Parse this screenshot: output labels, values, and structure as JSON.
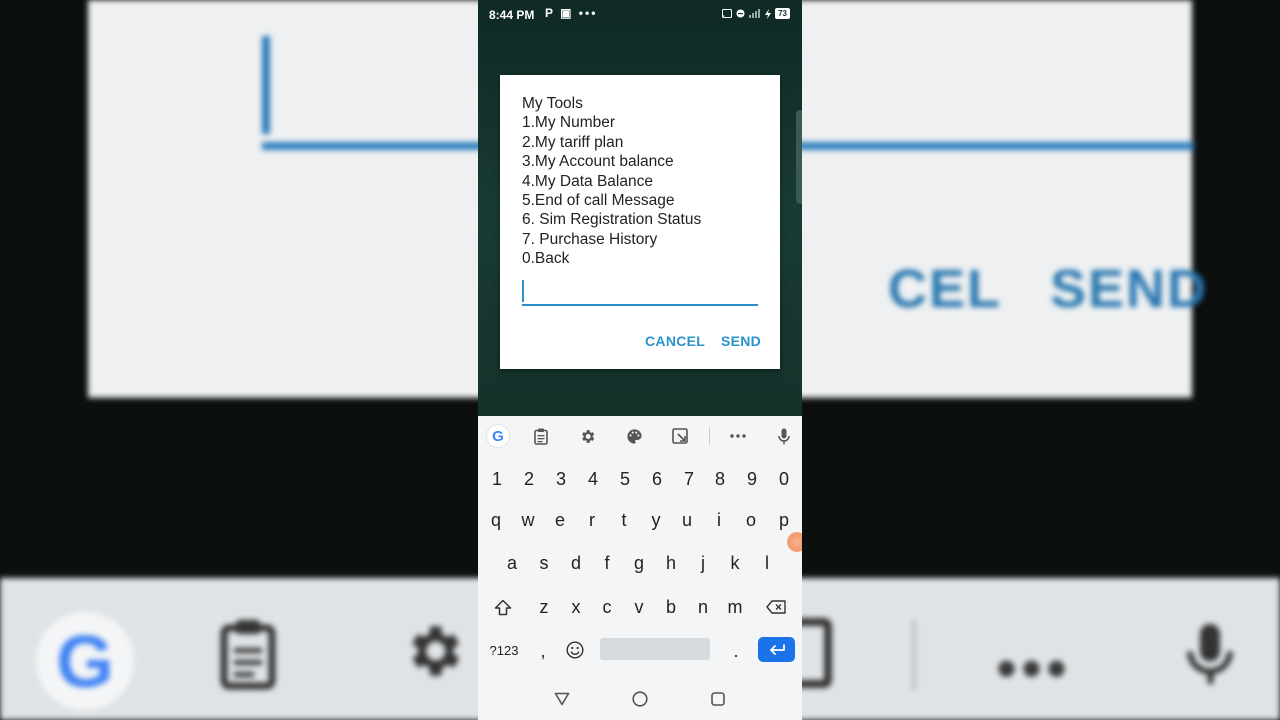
{
  "status_bar": {
    "time": "8:44 PM",
    "notification_text": "P ▣ •••",
    "icons": [
      "cast-icon",
      "dnd-icon",
      "signal-icon",
      "charging-icon"
    ],
    "battery": "73"
  },
  "ussd_dialog": {
    "lines": [
      "My Tools",
      "1.My Number",
      "2.My tariff plan",
      "3.My Account balance",
      "4.My Data Balance",
      "5.End of call Message",
      "6. Sim Registration Status",
      "7. Purchase History",
      "0.Back"
    ],
    "input_value": "",
    "cancel_label": "CANCEL",
    "send_label": "SEND"
  },
  "background_zoom": {
    "cancel_fragment": "CEL",
    "send_label": "SEND"
  },
  "keyboard": {
    "toolbar_icons": [
      "google-icon",
      "clipboard-icon",
      "settings-icon",
      "palette-icon",
      "resize-icon",
      "more-icon",
      "mic-icon"
    ],
    "row_numbers": [
      "1",
      "2",
      "3",
      "4",
      "5",
      "6",
      "7",
      "8",
      "9",
      "0"
    ],
    "row_top": [
      "q",
      "w",
      "e",
      "r",
      "t",
      "y",
      "u",
      "i",
      "o",
      "p"
    ],
    "row_middle": [
      "a",
      "s",
      "d",
      "f",
      "g",
      "h",
      "j",
      "k",
      "l"
    ],
    "row_bottom": [
      "z",
      "x",
      "c",
      "v",
      "b",
      "n",
      "m"
    ],
    "symbols_label": "?123",
    "comma_label": ",",
    "period_label": "."
  },
  "colors": {
    "accent": "#2a93c9",
    "enter_key": "#1a73e8",
    "phone_background": "#173530"
  }
}
